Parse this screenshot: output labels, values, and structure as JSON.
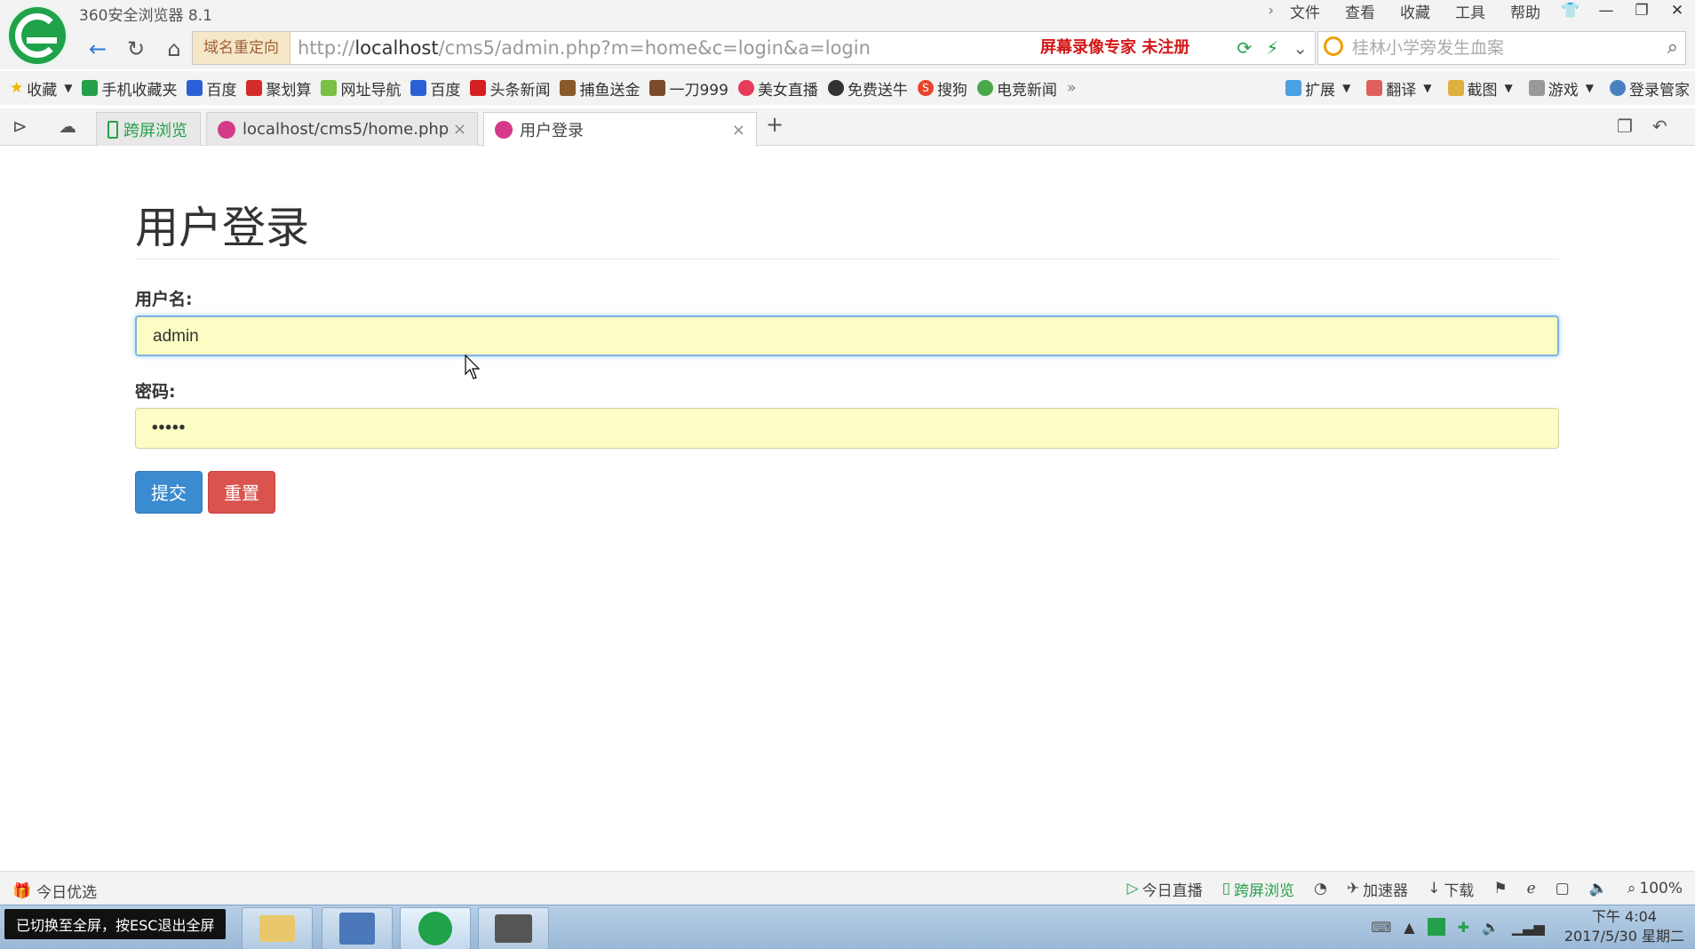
{
  "browser": {
    "app_title": "360安全浏览器 8.1",
    "menu": [
      "文件",
      "查看",
      "收藏",
      "工具",
      "帮助"
    ],
    "redirect_label": "域名重定向",
    "url_prefix": "http://",
    "url_host": "localhost",
    "url_path": "/cms5/admin.php?m=home&c=login&a=login",
    "watermark": "屏幕录像专家  未注册",
    "search_placeholder": "桂林小学旁发生血案"
  },
  "bookmarks": {
    "items": [
      "收藏",
      "手机收藏夹",
      "百度",
      "聚划算",
      "网址导航",
      "百度",
      "头条新闻",
      "捕鱼送金",
      "一刀999",
      "美女直播",
      "免费送牛",
      "搜狗",
      "电竞新闻"
    ],
    "right": [
      "扩展",
      "翻译",
      "截图",
      "游戏",
      "登录管家"
    ]
  },
  "tabs": {
    "pinned": "跨屏浏览",
    "items": [
      {
        "label": "localhost/cms5/home.php"
      },
      {
        "label": "用户登录"
      }
    ]
  },
  "page": {
    "title": "用户登录",
    "username_label": "用户名:",
    "username_value": "admin",
    "password_label": "密码:",
    "password_value": "•••••",
    "submit_label": "提交",
    "reset_label": "重置"
  },
  "statusbar": {
    "left": "今日优选",
    "items": [
      "今日直播",
      "跨屏浏览",
      "加速器",
      "下载"
    ],
    "zoom": "100%"
  },
  "taskbar": {
    "toast": "已切换至全屏，按ESC退出全屏",
    "time": "下午 4:04",
    "date": "2017/5/30 星期二"
  },
  "colors": {
    "brand_green": "#1fa24a",
    "input_bg": "#fbfdc4",
    "submit": "#3a8bd0",
    "reset": "#d9534f"
  }
}
